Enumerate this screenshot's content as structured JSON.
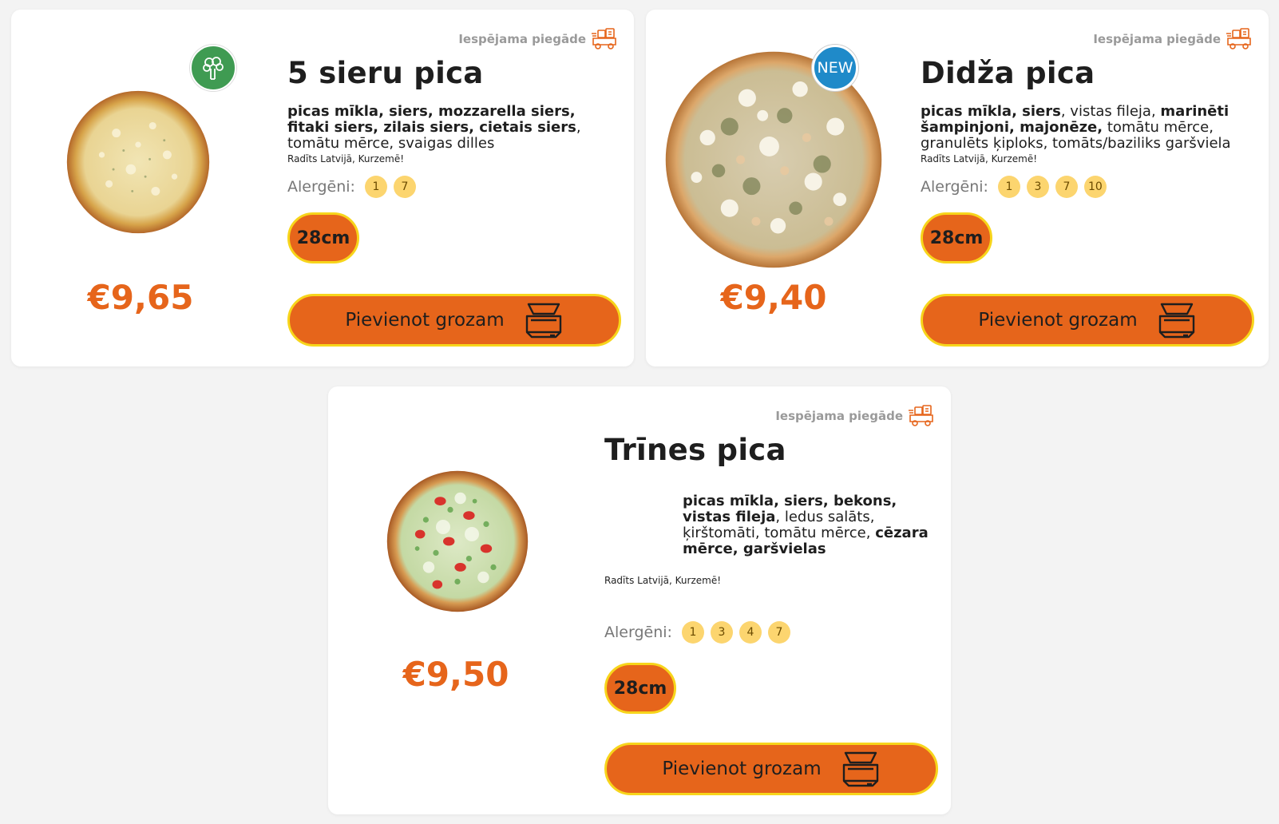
{
  "cards": [
    {
      "delivery": "Iespējama piegāde",
      "title": "5 sieru pica",
      "desc_bold": "picas mīkla, siers, mozzarella siers, fitaki siers, zilais siers, cietais siers",
      "desc_rest": ", tomātu mērce, svaigas dilles",
      "origin": "Radīts Latvijā, Kurzemē!",
      "allergens_label": "Alergēni:",
      "allergens": [
        "1",
        "7"
      ],
      "size": "28cm",
      "price": "€9,65",
      "cart": "Pievienot grozam",
      "badge": "vegetarian-icon"
    },
    {
      "delivery": "Iespējama piegāde",
      "title": "Didža pica",
      "desc_parts": [
        {
          "t": "picas mīkla, siers",
          "b": true
        },
        {
          "t": ", vistas fileja, ",
          "b": false
        },
        {
          "t": "marinēti šampinjoni, majonēze,",
          "b": true
        },
        {
          "t": " tomātu mērce, granulēts ķiploks, tomāts/baziliks garšviela",
          "b": false
        }
      ],
      "origin": "Radīts Latvijā, Kurzemē!",
      "allergens_label": "Alergēni:",
      "allergens": [
        "1",
        "3",
        "7",
        "10"
      ],
      "size": "28cm",
      "price": "€9,40",
      "cart": "Pievienot grozam",
      "badge": "NEW"
    },
    {
      "delivery": "Iespējama piegāde",
      "title": "Trīnes pica",
      "desc_parts": [
        {
          "t": "picas mīkla, siers, bekons, vistas fileja",
          "b": true
        },
        {
          "t": ", ledus salāts, ķirštomāti, tomātu mērce, ",
          "b": false
        },
        {
          "t": "cēzara mērce, garšvielas",
          "b": true
        }
      ],
      "origin": "Radīts Latvijā, Kurzemē!",
      "allergens_label": "Alergēni:",
      "allergens": [
        "1",
        "3",
        "4",
        "7"
      ],
      "size": "28cm",
      "price": "€9,50",
      "cart": "Pievienot grozam"
    }
  ],
  "colors": {
    "accent": "#e6651b",
    "button_border": "#f7d51b",
    "allergen_bg": "#fcd56f",
    "veg_badge": "#3f9b52",
    "new_badge": "#1f8ac9"
  }
}
